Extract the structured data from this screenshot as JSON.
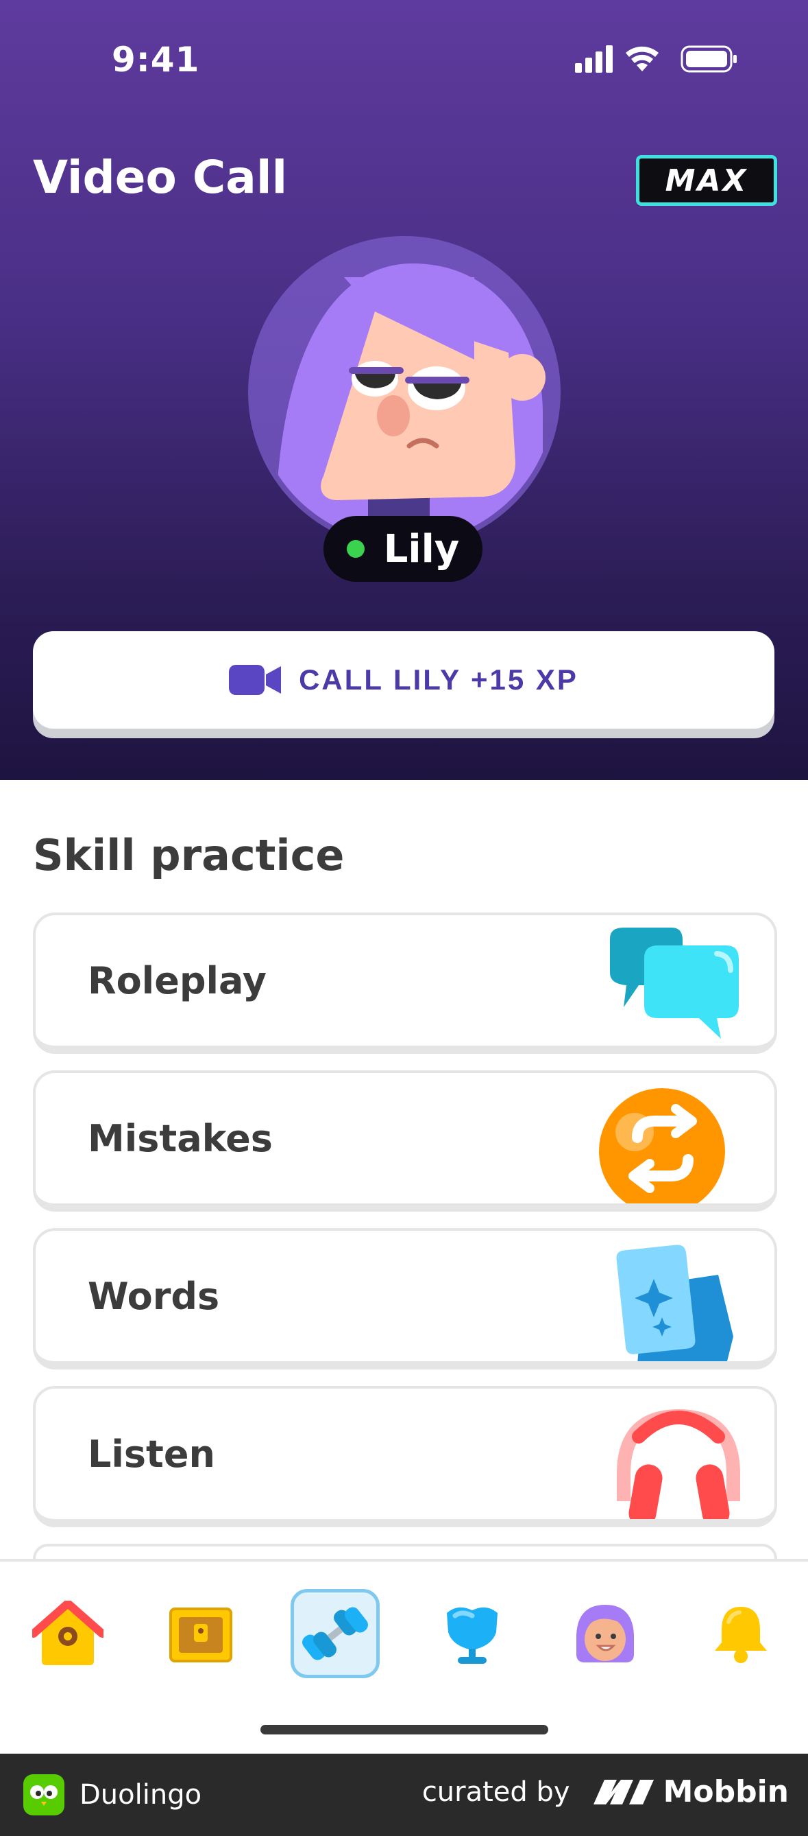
{
  "status_bar": {
    "time": "9:41"
  },
  "header": {
    "title": "Video Call",
    "badge": "MAX"
  },
  "character": {
    "name": "Lily",
    "online_color": "#3ad24f"
  },
  "call_button": {
    "label": "CALL LILY +15 XP",
    "icon": "video-camera-icon"
  },
  "skill_practice": {
    "title": "Skill practice",
    "items": [
      {
        "label": "Roleplay",
        "icon": "chat-bubbles-icon"
      },
      {
        "label": "Mistakes",
        "icon": "retry-arrows-icon"
      },
      {
        "label": "Words",
        "icon": "word-cards-icon"
      },
      {
        "label": "Listen",
        "icon": "headphones-icon"
      }
    ]
  },
  "bottom_nav": {
    "items": [
      {
        "icon": "home-icon"
      },
      {
        "icon": "treasure-chest-icon"
      },
      {
        "icon": "dumbbell-icon",
        "active": true
      },
      {
        "icon": "shield-trophy-icon"
      },
      {
        "icon": "profile-avatar-icon"
      },
      {
        "icon": "bell-icon"
      }
    ]
  },
  "footer": {
    "app_name": "Duolingo",
    "curated_by": "curated by",
    "brand": "Mobbin"
  },
  "colors": {
    "hero_top": "#5e3b9e",
    "hero_bottom": "#1e1440",
    "accent": "#4b3aa8",
    "max_border": "#3ee0e0"
  }
}
